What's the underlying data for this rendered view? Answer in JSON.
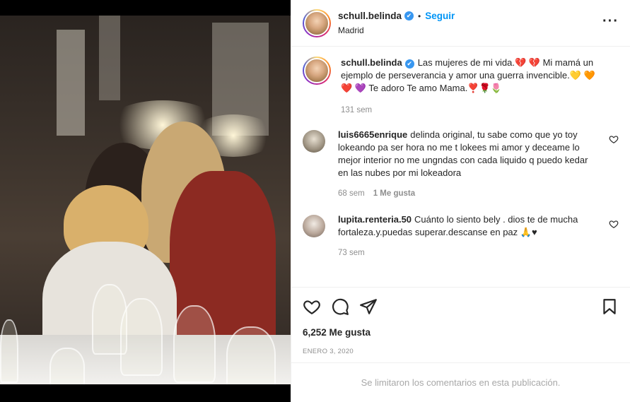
{
  "post": {
    "username": "schull.belinda",
    "verified_glyph": "✔",
    "separator": "•",
    "follow_label": "Seguir",
    "location": "Madrid",
    "more_icon": "more-icon"
  },
  "caption": {
    "username": "schull.belinda",
    "text": "Las mujeres de mi vida.💔 💔 Mi mamá un ejemplo de perseverancia y amor una guerra invencible.💛 🧡 ❤️ 💜 Te adoro Te amo Mama.❣️🌹🌷",
    "time": "131 sem"
  },
  "comments": [
    {
      "username": "luis6665enrique",
      "text": "delinda original, tu sabe como que yo toy lokeando pa ser hora no me t lokees mi amor y deceame lo mejor interior no me ungndas con cada liquido q puedo kedar en las nubes por mi lokeadora",
      "time": "68 sem",
      "likes": "1 Me gusta",
      "avatar_color": "#9a8f7e"
    },
    {
      "username": "lupita.renteria.50",
      "text": "Cuánto lo siento bely . dios te de mucha fortaleza.y.puedas superar.descanse en paz 🙏♥",
      "time": "73 sem",
      "likes": "",
      "avatar_color": "#b9a79a"
    }
  ],
  "footer": {
    "likes": "6,252 Me gusta",
    "date": "ENERO 3, 2020",
    "limited_notice": "Se limitaron los comentarios en esta publicación."
  },
  "colors": {
    "accent": "#0095f6",
    "verified": "#3897f0",
    "muted": "#8e8e8e"
  }
}
